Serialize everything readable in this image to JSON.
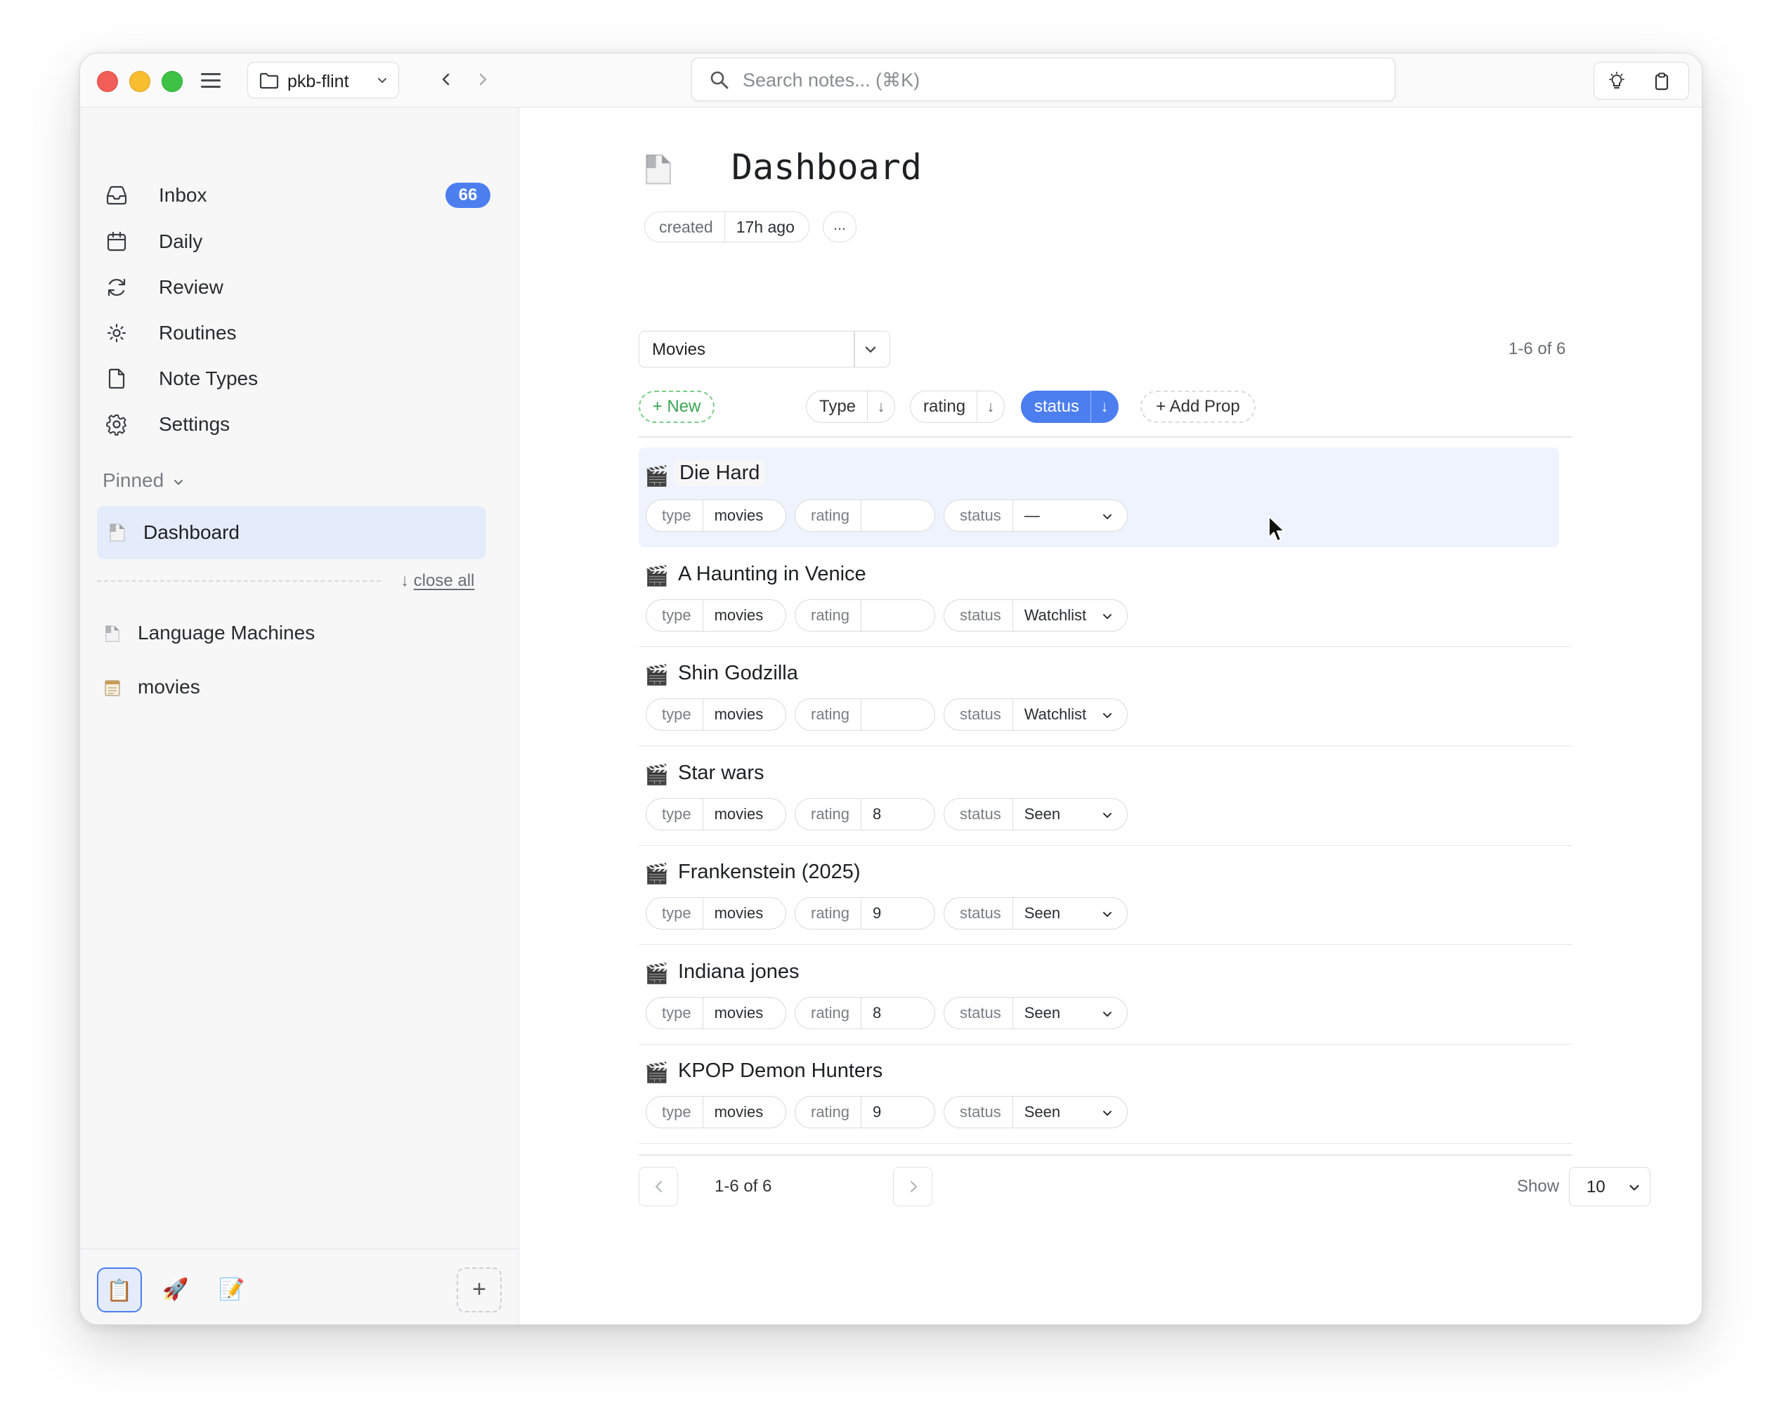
{
  "titlebar": {
    "vault_name": "pkb-flint",
    "search_placeholder": "Search notes... (⌘K)"
  },
  "sidebar": {
    "nav": [
      {
        "label": "Inbox",
        "badge": "66",
        "icon": "inbox-icon"
      },
      {
        "label": "Daily",
        "icon": "calendar-icon"
      },
      {
        "label": "Review",
        "icon": "refresh-icon"
      },
      {
        "label": "Routines",
        "icon": "sun-icon"
      },
      {
        "label": "Note Types",
        "icon": "file-icon"
      },
      {
        "label": "Settings",
        "icon": "gear-icon"
      }
    ],
    "pinned_header": "Pinned",
    "pinned": [
      {
        "label": "Dashboard",
        "icon": "page-icon"
      }
    ],
    "close_all": "close all",
    "recent": [
      {
        "label": "Language Machines",
        "icon": "page-icon"
      },
      {
        "label": "movies",
        "icon": "notepad-icon"
      }
    ],
    "workspaces": [
      {
        "emoji": "📋",
        "active": true
      },
      {
        "emoji": "🚀",
        "active": false
      },
      {
        "emoji": "📝",
        "active": false
      }
    ],
    "add_workspace": "+"
  },
  "page": {
    "title": "Dashboard",
    "meta_key": "created",
    "meta_value": "17h ago",
    "meta_more": "..."
  },
  "view": {
    "selected": "Movies",
    "count": "1-6 of 6",
    "new_label": "+ New",
    "sorts": [
      {
        "label": "Type",
        "arrow": "↓",
        "active": false
      },
      {
        "label": "rating",
        "arrow": "↓",
        "active": false
      },
      {
        "label": "status",
        "arrow": "↓",
        "active": true
      }
    ],
    "add_prop_label": "+ Add Prop"
  },
  "rows": [
    {
      "icon": "🎬",
      "title": "Die Hard",
      "type_key": "type",
      "type": "movies",
      "rating_key": "rating",
      "rating": "",
      "status_key": "status",
      "status": "—"
    },
    {
      "icon": "🎬",
      "title": "A Haunting in Venice",
      "type_key": "type",
      "type": "movies",
      "rating_key": "rating",
      "rating": "",
      "status_key": "status",
      "status": "Watchlist"
    },
    {
      "icon": "🎬",
      "title": "Shin Godzilla",
      "type_key": "type",
      "type": "movies",
      "rating_key": "rating",
      "rating": "",
      "status_key": "status",
      "status": "Watchlist"
    },
    {
      "icon": "🎬",
      "title": "Star wars",
      "type_key": "type",
      "type": "movies",
      "rating_key": "rating",
      "rating": "8",
      "status_key": "status",
      "status": "Seen"
    },
    {
      "icon": "🎬",
      "title": "Frankenstein (2025)",
      "type_key": "type",
      "type": "movies",
      "rating_key": "rating",
      "rating": "9",
      "status_key": "status",
      "status": "Seen"
    },
    {
      "icon": "🎬",
      "title": "Indiana jones",
      "type_key": "type",
      "type": "movies",
      "rating_key": "rating",
      "rating": "8",
      "status_key": "status",
      "status": "Seen"
    },
    {
      "icon": "🎬",
      "title": "KPOP Demon Hunters",
      "type_key": "type",
      "type": "movies",
      "rating_key": "rating",
      "rating": "9",
      "status_key": "status",
      "status": "Seen"
    }
  ],
  "pager": {
    "label": "1-6 of 6",
    "show_label": "Show",
    "page_size": "10"
  },
  "colors": {
    "accent": "#4c7ef0",
    "new_green": "#3aa553",
    "highlight_row": "#eef3fd"
  }
}
